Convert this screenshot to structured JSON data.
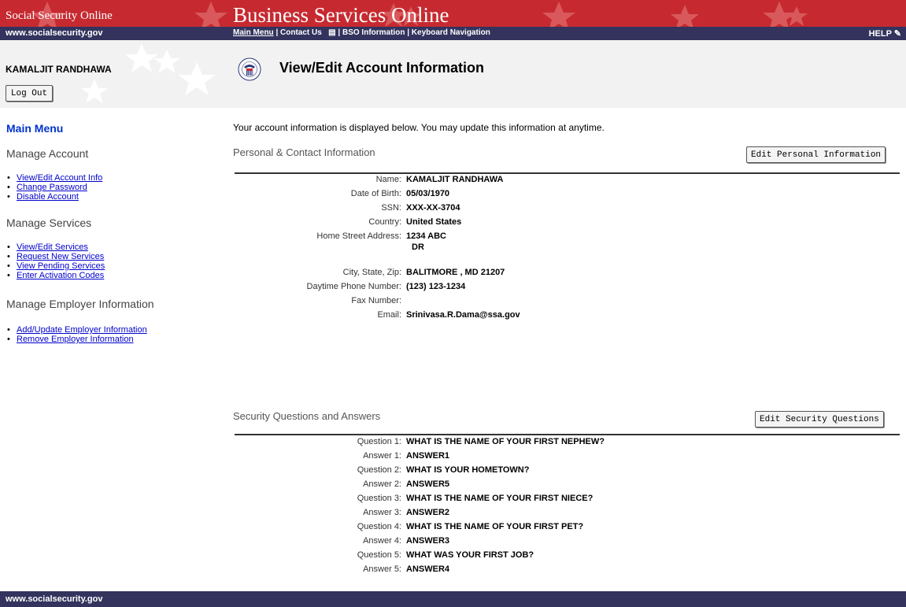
{
  "header": {
    "left_text": "Social Security Online",
    "title": "Business Services Online"
  },
  "navbar": {
    "site": "www.socialsecurity.gov",
    "links": [
      {
        "label": "Main Menu"
      },
      {
        "label": "Contact Us"
      },
      {
        "label": "BSO Information"
      },
      {
        "label": "Keyboard Navigation"
      }
    ],
    "help": "HELP"
  },
  "user": {
    "name": "KAMALJIT RANDHAWA",
    "logout_label": "Log Out"
  },
  "page": {
    "title": "View/Edit Account Information",
    "intro": "Your account information is displayed below. You may update this information at anytime."
  },
  "sidebar": {
    "main_menu": "Main Menu",
    "sections": [
      {
        "heading": "Manage Account",
        "items": [
          "View/Edit Account Info",
          "Change Password",
          "Disable Account"
        ]
      },
      {
        "heading": "Manage Services",
        "items": [
          "View/Edit Services",
          "Request New Services",
          "View Pending Services",
          "Enter Activation Codes"
        ]
      },
      {
        "heading": "Manage Employer Information",
        "items": [
          "Add/Update Employer Information",
          "Remove Employer Information"
        ]
      }
    ]
  },
  "personal": {
    "title": "Personal & Contact Information",
    "edit_label": "Edit Personal Information",
    "fields": [
      {
        "label": "Name:",
        "value": "KAMALJIT  RANDHAWA"
      },
      {
        "label": "Date of Birth:",
        "value": "05/03/1970"
      },
      {
        "label": "SSN:",
        "value": "XXX-XX-3704"
      },
      {
        "label": "Country:",
        "value": "United States"
      },
      {
        "label": "Home Street Address:",
        "value": "1234 ABC",
        "value2": "DR"
      },
      {
        "label": "City, State, Zip:",
        "value": "BALITMORE , MD 21207"
      },
      {
        "label": "Daytime Phone Number:",
        "value": "(123) 123-1234"
      },
      {
        "label": "Fax Number:",
        "value": ""
      },
      {
        "label": "Email:",
        "value": "Srinivasa.R.Dama@ssa.gov"
      }
    ]
  },
  "security": {
    "title": "Security Questions and Answers",
    "edit_label": "Edit Security Questions",
    "rows": [
      {
        "label": "Question 1:",
        "value": "WHAT IS THE NAME OF YOUR FIRST NEPHEW?"
      },
      {
        "label": "Answer 1:",
        "value": "ANSWER1"
      },
      {
        "label": "Question 2:",
        "value": "WHAT IS YOUR HOMETOWN?"
      },
      {
        "label": "Answer 2:",
        "value": "ANSWER5"
      },
      {
        "label": "Question 3:",
        "value": "WHAT IS THE NAME OF YOUR FIRST NIECE?"
      },
      {
        "label": "Answer 3:",
        "value": "ANSWER2"
      },
      {
        "label": "Question 4:",
        "value": "WHAT IS THE NAME OF YOUR FIRST PET?"
      },
      {
        "label": "Answer 4:",
        "value": "ANSWER3"
      },
      {
        "label": "Question 5:",
        "value": "WHAT WAS YOUR FIRST JOB?"
      },
      {
        "label": "Answer 5:",
        "value": "ANSWER4"
      }
    ]
  },
  "seal_text": {
    "top": "SOCIAL SECURITY",
    "center": "USA",
    "bottom": "ADMINISTRATION"
  },
  "footer": {
    "site": "www.socialsecurity.gov"
  },
  "colors": {
    "header_red": "#c62a30",
    "nav_navy": "#33335e",
    "link_blue": "#0000cc",
    "main_menu_blue": "#0033cc"
  }
}
